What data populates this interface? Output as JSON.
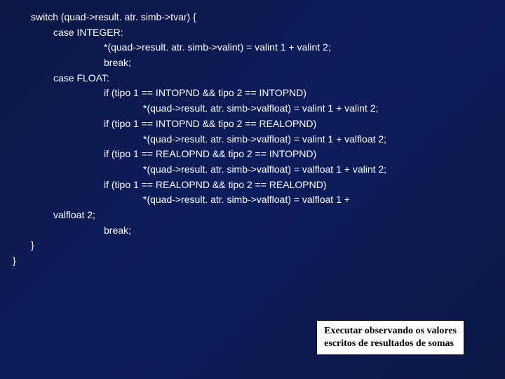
{
  "code": {
    "l0": "switch (quad->result. atr. simb->tvar) {",
    "l1": "case INTEGER:",
    "l2": "*(quad->result. atr. simb->valint) = valint 1 + valint 2;",
    "l3": "break;",
    "l4": "case FLOAT:",
    "l5": "if (tipo 1 == INTOPND && tipo 2 == INTOPND)",
    "l6": "*(quad->result. atr. simb->valfloat) = valint 1 + valint 2;",
    "l7": "if (tipo 1 == INTOPND && tipo 2 == REALOPND)",
    "l8": "*(quad->result. atr. simb->valfloat) = valint 1 + valfloat 2;",
    "l9": "if (tipo 1 == REALOPND && tipo 2 == INTOPND)",
    "l10": "*(quad->result. atr. simb->valfloat) = valfloat 1 + valint 2;",
    "l11": "if (tipo 1 == REALOPND && tipo 2 == REALOPND)",
    "l12": "*(quad->result. atr. simb->valfloat) = valfloat 1 +",
    "l13": "valfloat 2;",
    "l14": "break;",
    "l15": "}",
    "l16": "}"
  },
  "callout": {
    "line1": "Executar observando os valores",
    "line2": "escritos de resultados de somas"
  }
}
